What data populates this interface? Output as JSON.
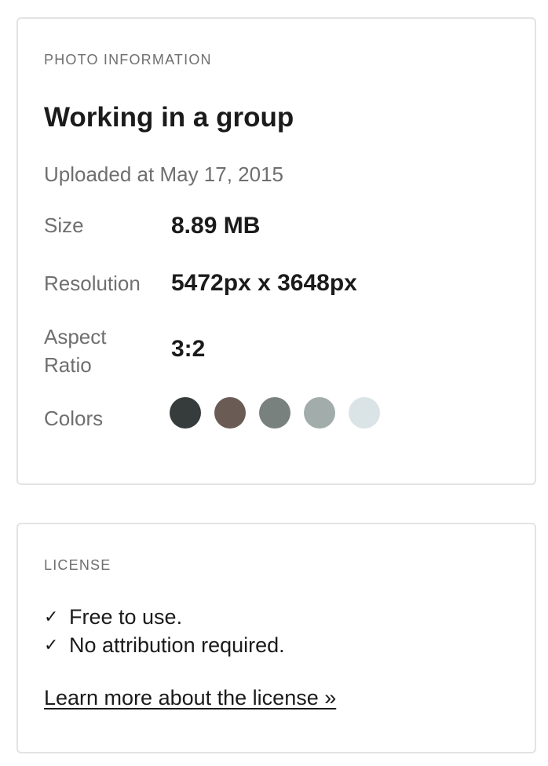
{
  "photo_info": {
    "section_label": "PHOTO INFORMATION",
    "title": "Working in a group",
    "uploaded_prefix": "Uploaded at ",
    "uploaded_date": "May 17, 2015",
    "size_label": "Size",
    "size_value": "8.89 MB",
    "resolution_label": "Resolution",
    "resolution_value": "5472px x 3648px",
    "aspect_label": "Aspect Ratio",
    "aspect_value": "3:2",
    "colors_label": "Colors",
    "colors": [
      "#353c3b",
      "#6a5b55",
      "#79817f",
      "#a2adab",
      "#dae3e6"
    ]
  },
  "license": {
    "section_label": "LICENSE",
    "check_icon": "check-icon",
    "items": [
      "Free to use.",
      "No attribution required."
    ],
    "link_text": "Learn more about the license »"
  }
}
